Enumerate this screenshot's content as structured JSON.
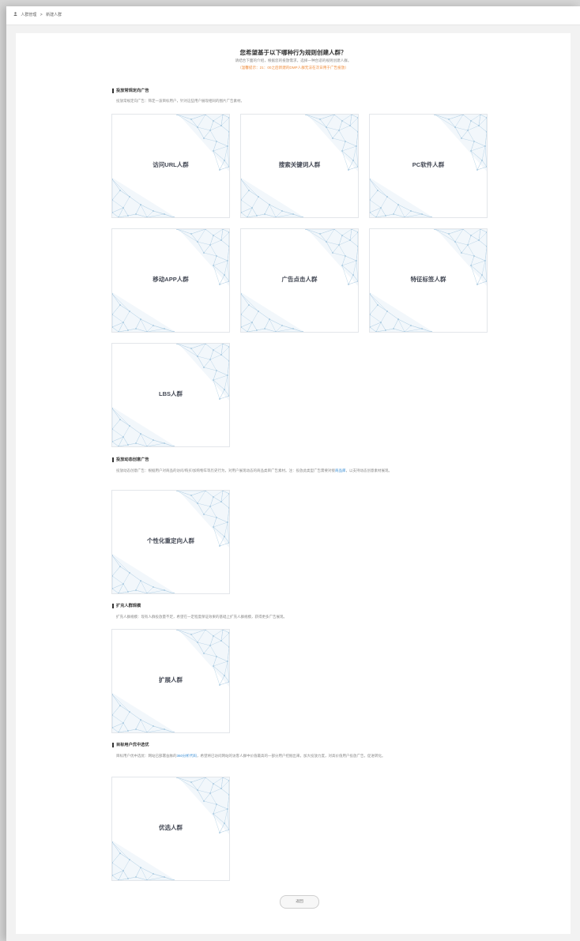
{
  "breadcrumb": {
    "root": "人群管理",
    "separator": ">",
    "current": "新建人群"
  },
  "header": {
    "title": "您希望基于以下哪种行为规则创建人群？",
    "subtitle": "请结合下面的介绍，根据您的投放需求，选择一种合适的规则创建人群。",
    "warning": "（温馨提示：21：00之后新建的DMP人群无法在次日用于广告投放）"
  },
  "sections": [
    {
      "title": "投放常规定向广告",
      "desc": "投放常规定向广告：筛定一波目标用户，针对这些用户展现相同的图片广告素材。",
      "tiles": [
        "访问URL人群",
        "搜索关键词人群",
        "PC软件人群",
        "移动APP人群",
        "广告点击人群",
        "特征标签人群",
        "LBS人群"
      ]
    },
    {
      "title": "投放动态创意广告",
      "desc_pre": "投放动态创意广告：根据用户对商品的访问/购买/加购物车等历史行为，对用户展现动态的商品类目广告素材。注：投放此类型广告需要对接",
      "desc_link": "商品库",
      "desc_post": "，以支持动态创意素材展现。",
      "tiles": [
        "个性化重定向人群"
      ]
    },
    {
      "title": "扩充人群规模",
      "desc": "扩充人群规模：现有人群投放量不足，希望在一定程度保证效果的基础上扩充人群规模，获得更多广告展现。",
      "tiles": [
        "扩展人群"
      ]
    },
    {
      "title": "目标用户优中选优",
      "desc_pre": "目标用户优中选优：网站已部署舍脉的",
      "desc_link": "360分析代码",
      "desc_post": "，希望将已访问网站的访客人群中价值最高的一部分用户挖掘出来，加大投放力度，对高价值用户投放广告，促进转化。",
      "tiles": [
        "优选人群"
      ]
    }
  ],
  "footer": {
    "back_label": "返回"
  }
}
